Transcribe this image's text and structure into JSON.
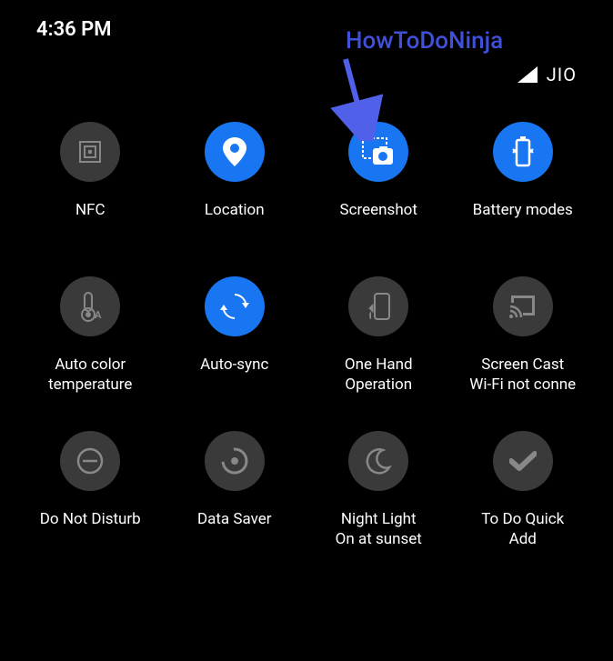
{
  "status": {
    "time": "4:36 PM",
    "carrier": "JIO"
  },
  "annotation": {
    "text": "HowToDoNinja"
  },
  "tiles": {
    "nfc": {
      "label": "NFC",
      "active": false
    },
    "location": {
      "label": "Location",
      "active": true
    },
    "screenshot": {
      "label": "Screenshot",
      "active": true
    },
    "battery": {
      "label": "Battery modes",
      "active": true
    },
    "autocolor": {
      "label": "Auto color\ntemperature",
      "active": false
    },
    "autosync": {
      "label": "Auto-sync",
      "active": true
    },
    "onehand": {
      "label": "One Hand\nOperation",
      "active": false
    },
    "screencast": {
      "label": "Screen Cast\nWi-Fi not conne",
      "active": false
    },
    "dnd": {
      "label": "Do Not Disturb",
      "active": false
    },
    "datasaver": {
      "label": "Data Saver",
      "active": false
    },
    "nightlight": {
      "label": "Night Light\nOn at sunset",
      "active": false
    },
    "todo": {
      "label": "To Do Quick\nAdd",
      "active": false
    }
  },
  "colors": {
    "active": "#1976f2",
    "inactive": "#3a3a3a",
    "annotation": "#4050d8"
  }
}
